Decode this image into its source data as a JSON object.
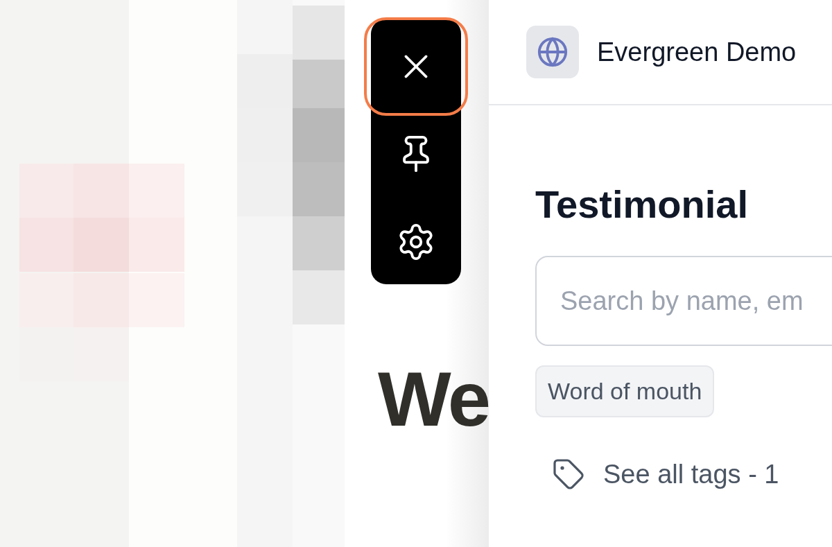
{
  "background_page": {
    "heading": "We"
  },
  "toolbar": {
    "buttons": [
      {
        "kind": "close",
        "highlighted": true
      },
      {
        "kind": "pin",
        "highlighted": false
      },
      {
        "kind": "settings",
        "highlighted": false
      }
    ]
  },
  "panel": {
    "workspace": "Evergreen Demo",
    "title": "Testimonial",
    "search": {
      "placeholder": "Search by name, em"
    },
    "tags": [
      {
        "label": "Word of mouth"
      }
    ],
    "see_all": "See all tags - 1"
  }
}
